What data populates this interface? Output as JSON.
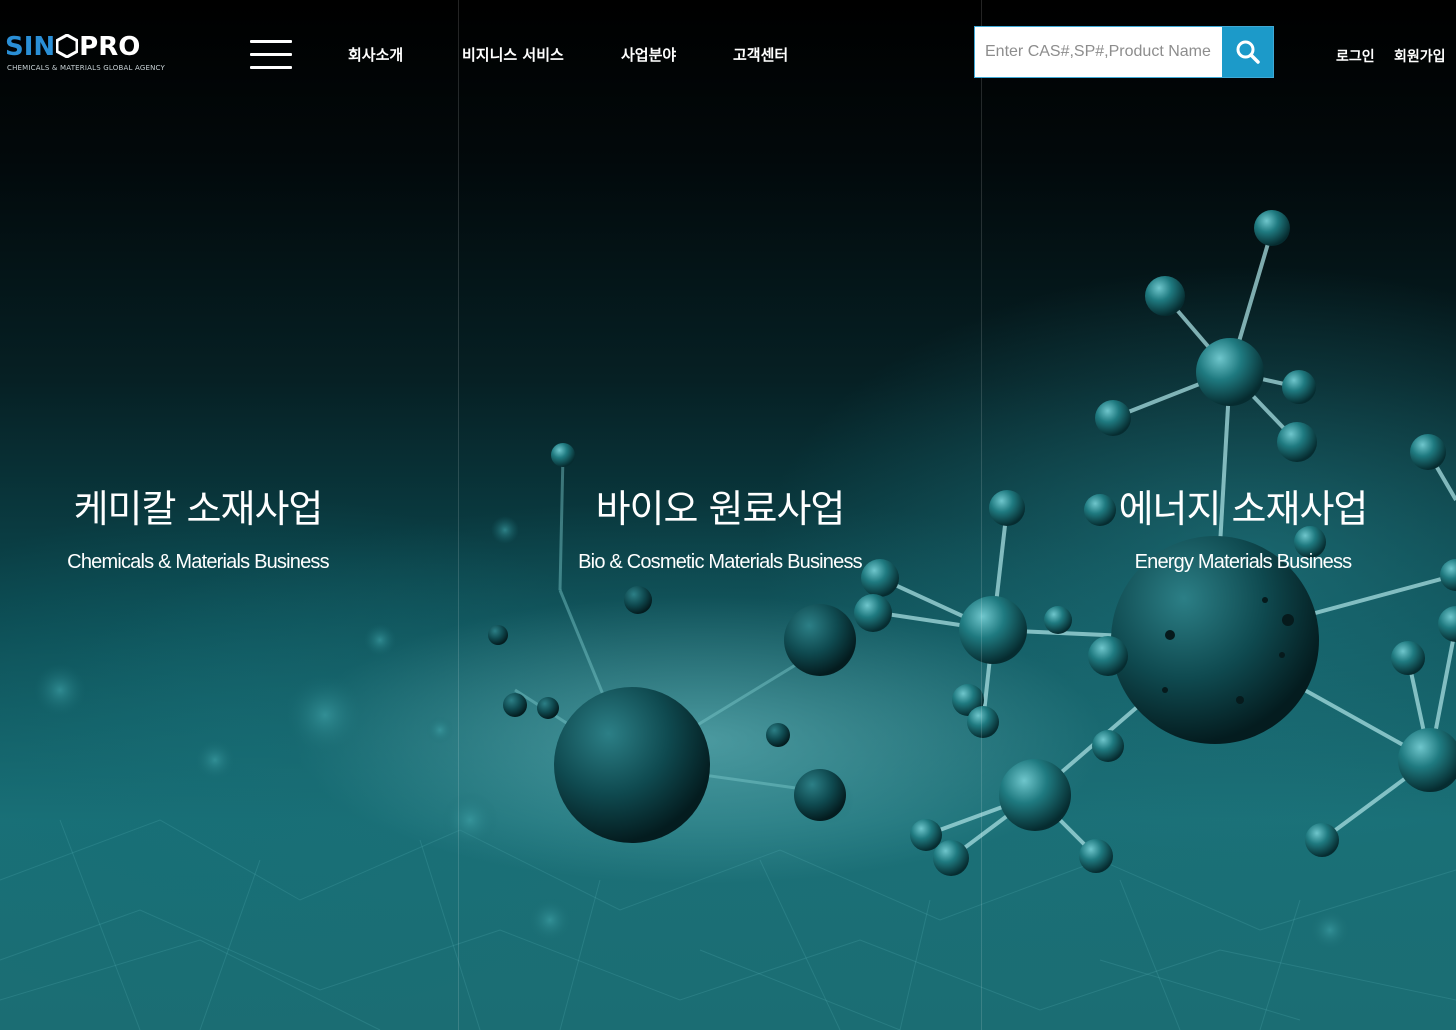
{
  "header": {
    "logo": {
      "text_left": "SIN",
      "text_right": "PRO",
      "tagline": "CHEMICALS & MATERIALS GLOBAL AGENCY"
    },
    "menu_icon": "hamburger-menu-icon",
    "nav": [
      {
        "label": "회사소개"
      },
      {
        "label": "비지니스 서비스"
      },
      {
        "label": "사업분야"
      },
      {
        "label": "고객센터"
      }
    ],
    "search": {
      "placeholder": "Enter CAS#,SP#,Product Name",
      "value": "",
      "button_icon": "search-icon"
    },
    "login": "로그인",
    "signup": "회원가입"
  },
  "sections": [
    {
      "title": "케미칼 소재사업",
      "subtitle": "Chemicals & Materials Business"
    },
    {
      "title": "바이오 원료사업",
      "subtitle": "Bio & Cosmetic Materials Business"
    },
    {
      "title": "에너지 소재사업",
      "subtitle": "Energy Materials Business"
    }
  ],
  "colors": {
    "accent_blue": "#1c9ac9",
    "logo_blue": "#2a8fd6",
    "background_teal": "#1b6d73"
  }
}
